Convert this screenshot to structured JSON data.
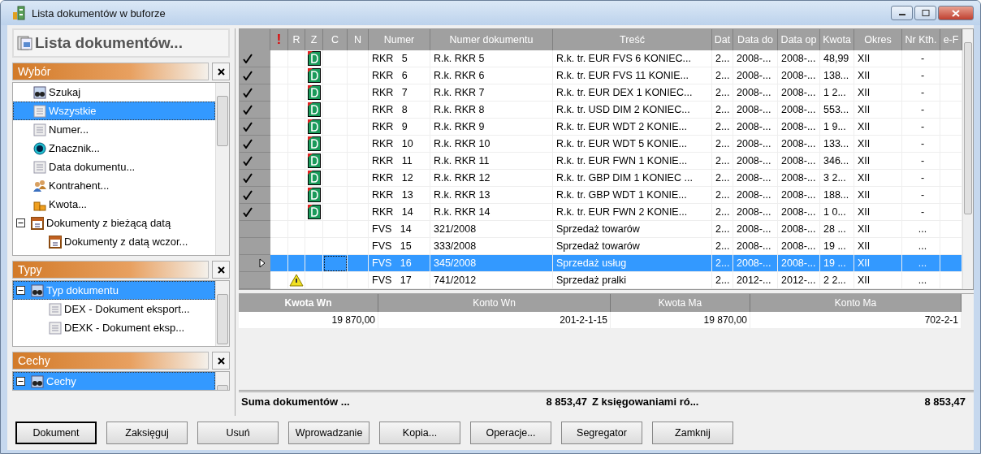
{
  "window": {
    "title": "Lista dokumentów w buforze"
  },
  "panel_title": "Lista dokumentów...",
  "sections": [
    {
      "title": "Wybór",
      "items": [
        {
          "label": "Szukaj",
          "kind": "search",
          "selected": false,
          "expanded": false
        },
        {
          "label": "Wszystkie",
          "kind": "list",
          "selected": true,
          "expanded": false
        },
        {
          "label": "Numer...",
          "kind": "list",
          "selected": false,
          "expanded": false
        },
        {
          "label": "Znacznik...",
          "kind": "marker",
          "selected": false,
          "expanded": false
        },
        {
          "label": "Data dokumentu...",
          "kind": "list",
          "selected": false,
          "expanded": false
        },
        {
          "label": "Kontrahent...",
          "kind": "contact",
          "selected": false,
          "expanded": false
        },
        {
          "label": "Kwota...",
          "kind": "amount",
          "selected": false,
          "expanded": false
        },
        {
          "label": "Dokumenty z bieżącą datą",
          "kind": "date",
          "selected": false,
          "expanded": true,
          "children": [
            {
              "label": "Dokumenty z datą wczor...",
              "kind": "date",
              "selected": false
            }
          ]
        }
      ]
    },
    {
      "title": "Typy",
      "items": [
        {
          "label": "Typ dokumentu",
          "kind": "search",
          "selected": true,
          "expanded": true,
          "children": [
            {
              "label": "DEX - Dokument eksport...",
              "kind": "list",
              "selected": false
            },
            {
              "label": "DEXK - Dokument eksp...",
              "kind": "list",
              "selected": false
            }
          ]
        }
      ]
    },
    {
      "title": "Cechy",
      "items": [
        {
          "label": "Cechy",
          "kind": "search",
          "selected": true,
          "expanded": true
        }
      ]
    }
  ],
  "table": {
    "columns": [
      {
        "kind": "indicator"
      },
      {
        "label": "!",
        "kind": "alert"
      },
      {
        "label": "R",
        "kind": "text"
      },
      {
        "label": "Z",
        "kind": "text"
      },
      {
        "label": "C",
        "kind": "text"
      },
      {
        "label": "N",
        "kind": "text"
      },
      {
        "label": "Numer",
        "kind": "text"
      },
      {
        "label": "Numer dokumentu",
        "kind": "text"
      },
      {
        "label": "Treść",
        "kind": "text"
      },
      {
        "label": "Dat",
        "kind": "text"
      },
      {
        "label": "Data do",
        "kind": "text"
      },
      {
        "label": "Data op",
        "kind": "text"
      },
      {
        "label": "Kwota",
        "kind": "text"
      },
      {
        "label": "Okres",
        "kind": "text"
      },
      {
        "label": "Nr Kth.",
        "kind": "text"
      },
      {
        "label": "e-F",
        "kind": "text"
      }
    ],
    "rows": [
      {
        "checked": true,
        "booked": true,
        "warning": false,
        "selected": false,
        "numer": "RKR   5",
        "numer_dok": "R.k. RKR 5",
        "tresc": "R.k. tr. EUR FVS 6 KONIEC...",
        "dat": "2...",
        "data_do": "2008-...",
        "data_op": "2008-...",
        "kwota": "48,99",
        "okres": "XII",
        "nr_kth": "-"
      },
      {
        "checked": true,
        "booked": true,
        "warning": false,
        "selected": false,
        "numer": "RKR   6",
        "numer_dok": "R.k. RKR 6",
        "tresc": "R.k. tr. EUR FVS 11 KONIE...",
        "dat": "2...",
        "data_do": "2008-...",
        "data_op": "2008-...",
        "kwota": "138...",
        "okres": "XII",
        "nr_kth": "-"
      },
      {
        "checked": true,
        "booked": true,
        "warning": false,
        "selected": false,
        "numer": "RKR   7",
        "numer_dok": "R.k. RKR 7",
        "tresc": "R.k. tr. EUR DEX 1 KONIEC...",
        "dat": "2...",
        "data_do": "2008-...",
        "data_op": "2008-...",
        "kwota": "1 2...",
        "okres": "XII",
        "nr_kth": "-"
      },
      {
        "checked": true,
        "booked": true,
        "warning": false,
        "selected": false,
        "numer": "RKR   8",
        "numer_dok": "R.k. RKR 8",
        "tresc": "R.k. tr. USD DIM 2 KONIEC...",
        "dat": "2...",
        "data_do": "2008-...",
        "data_op": "2008-...",
        "kwota": "553...",
        "okres": "XII",
        "nr_kth": "-"
      },
      {
        "checked": true,
        "booked": true,
        "warning": false,
        "selected": false,
        "numer": "RKR   9",
        "numer_dok": "R.k. RKR 9",
        "tresc": "R.k. tr. EUR WDT 2 KONIE...",
        "dat": "2...",
        "data_do": "2008-...",
        "data_op": "2008-...",
        "kwota": "1 9...",
        "okres": "XII",
        "nr_kth": "-"
      },
      {
        "checked": true,
        "booked": true,
        "warning": false,
        "selected": false,
        "numer": "RKR   10",
        "numer_dok": "R.k. RKR 10",
        "tresc": "R.k. tr. EUR WDT 5 KONIE...",
        "dat": "2...",
        "data_do": "2008-...",
        "data_op": "2008-...",
        "kwota": "133...",
        "okres": "XII",
        "nr_kth": "-"
      },
      {
        "checked": true,
        "booked": true,
        "warning": false,
        "selected": false,
        "numer": "RKR   11",
        "numer_dok": "R.k. RKR 11",
        "tresc": "R.k. tr. EUR FWN 1 KONIE...",
        "dat": "2...",
        "data_do": "2008-...",
        "data_op": "2008-...",
        "kwota": "346...",
        "okres": "XII",
        "nr_kth": "-"
      },
      {
        "checked": true,
        "booked": true,
        "warning": false,
        "selected": false,
        "numer": "RKR   12",
        "numer_dok": "R.k. RKR 12",
        "tresc": "R.k. tr. GBP DIM 1 KONIEC ...",
        "dat": "2...",
        "data_do": "2008-...",
        "data_op": "2008-...",
        "kwota": "3 2...",
        "okres": "XII",
        "nr_kth": "-"
      },
      {
        "checked": true,
        "booked": true,
        "warning": false,
        "selected": false,
        "numer": "RKR   13",
        "numer_dok": "R.k. RKR 13",
        "tresc": "R.k. tr. GBP WDT 1 KONIE...",
        "dat": "2...",
        "data_do": "2008-...",
        "data_op": "2008-...",
        "kwota": "188...",
        "okres": "XII",
        "nr_kth": "-"
      },
      {
        "checked": true,
        "booked": true,
        "warning": false,
        "selected": false,
        "numer": "RKR   14",
        "numer_dok": "R.k. RKR 14",
        "tresc": "R.k. tr. EUR FWN 2 KONIE...",
        "dat": "2...",
        "data_do": "2008-...",
        "data_op": "2008-...",
        "kwota": "1 0...",
        "okres": "XII",
        "nr_kth": "-"
      },
      {
        "checked": false,
        "booked": false,
        "warning": false,
        "selected": false,
        "numer": "FVS   14",
        "numer_dok": "321/2008",
        "tresc": "Sprzedaż towarów",
        "dat": "2...",
        "data_do": "2008-...",
        "data_op": "2008-...",
        "kwota": "28 ...",
        "okres": "XII",
        "nr_kth": "..."
      },
      {
        "checked": false,
        "booked": false,
        "warning": false,
        "selected": false,
        "numer": "FVS   15",
        "numer_dok": "333/2008",
        "tresc": "Sprzedaż towarów",
        "dat": "2...",
        "data_do": "2008-...",
        "data_op": "2008-...",
        "kwota": "19 ...",
        "okres": "XII",
        "nr_kth": "..."
      },
      {
        "checked": false,
        "booked": false,
        "warning": false,
        "selected": true,
        "numer": "FVS   16",
        "numer_dok": "345/2008",
        "tresc": "Sprzedaż usług",
        "dat": "2...",
        "data_do": "2008-...",
        "data_op": "2008-...",
        "kwota": "19 ...",
        "okres": "XII",
        "nr_kth": "..."
      },
      {
        "checked": false,
        "booked": false,
        "warning": true,
        "selected": false,
        "numer": "FVS   17",
        "numer_dok": "741/2012",
        "tresc": "Sprzedaż pralki",
        "dat": "2...",
        "data_do": "2012-...",
        "data_op": "2012-...",
        "kwota": "2 2...",
        "okres": "XII",
        "nr_kth": "..."
      }
    ]
  },
  "postings": {
    "columns": [
      "Kwota Wn",
      "Konto Wn",
      "Kwota Ma",
      "Konto Ma"
    ],
    "rows": [
      [
        "19 870,00",
        "201-2-1-15",
        "19 870,00",
        "702-2-1"
      ]
    ]
  },
  "summary": {
    "label": "Suma dokumentów ...",
    "total": "8 853,47",
    "label_2": "Z księgowaniami ró...",
    "total_2": "8 853,47"
  },
  "buttons": [
    {
      "label": "Dokument",
      "default": true
    },
    {
      "label": "Zaksięguj",
      "default": false
    },
    {
      "label": "Usuń",
      "default": false
    },
    {
      "label": "Wprowadzanie",
      "default": false
    },
    {
      "label": "Kopia...",
      "default": false
    },
    {
      "label": "Operacje...",
      "default": false
    },
    {
      "label": "Segregator",
      "default": false
    },
    {
      "label": "Zamknij",
      "default": false
    }
  ]
}
